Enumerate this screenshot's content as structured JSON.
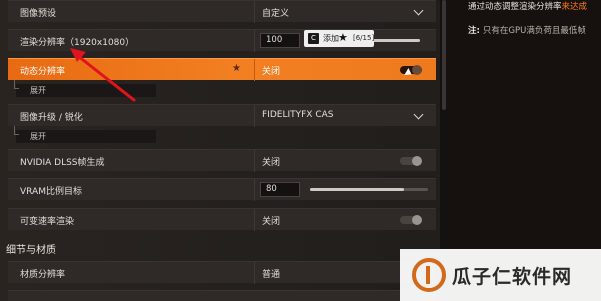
{
  "settings": {
    "rows": [
      {
        "label": "图像预设",
        "value": "自定义"
      },
      {
        "label": "渲染分辨率（1920x1080）",
        "value": "100"
      },
      {
        "label": "动态分辨率",
        "value": "关闭"
      },
      {
        "label": "图像升级 / 锐化",
        "value": "FIDELITYFX CAS"
      },
      {
        "label": "NVIDIA DLSS帧生成",
        "value": "关闭"
      },
      {
        "label": "VRAM比例目标",
        "value": "80"
      },
      {
        "label": "可变速率渲染",
        "value": "关闭"
      },
      {
        "label": "材质分辨率",
        "value": "普通"
      }
    ],
    "sub_expand_1": "展开",
    "sub_expand_2": "展开",
    "section_title": "细节与材质"
  },
  "sliders": {
    "render_resolution_percent": 100,
    "vram_target_percent": 80
  },
  "tooltip": {
    "badge": "C",
    "text": "添加",
    "page": "[6/15]"
  },
  "info_panel": {
    "line1_prefix": "通过动态调整渲染分辨率",
    "line1_highlight": "来达成",
    "note_label": "注:",
    "note_text": "只有在GPU满负荷且最低帧"
  },
  "watermark": {
    "text": "瓜子仁软件网"
  },
  "colors": {
    "accent": "#f07a1c",
    "panel_bg": "#2f2a27",
    "info_bg": "#16110f"
  },
  "icons": [
    "chevron-down-icon",
    "star-icon",
    "toggle-switch",
    "cursor-icon",
    "red-arrow-annotation"
  ]
}
